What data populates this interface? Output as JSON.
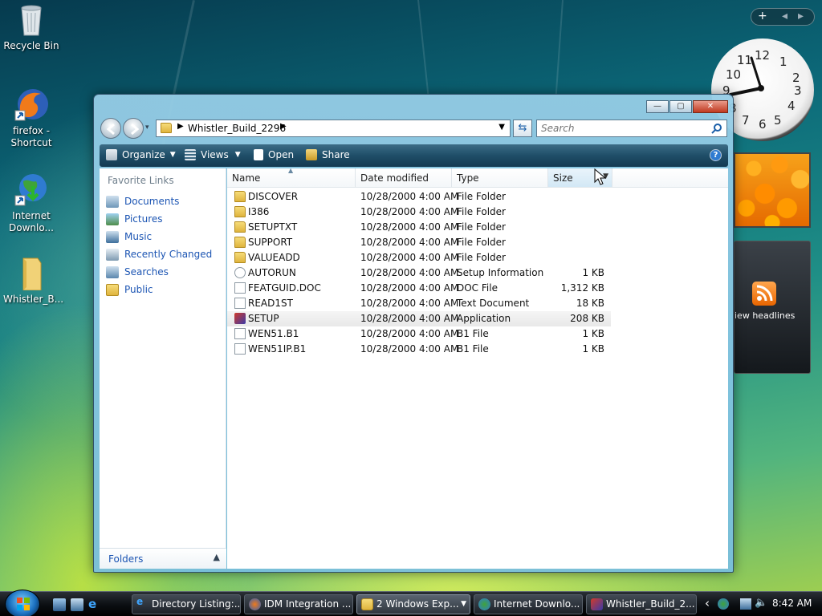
{
  "desktop": {
    "icons": [
      {
        "label": "Recycle Bin"
      },
      {
        "label": "firefox -\nShortcut"
      },
      {
        "label": "Internet\nDownlo..."
      },
      {
        "label": "Whistler_B..."
      }
    ]
  },
  "gadgets": {
    "clock_numbers": [
      "12",
      "1",
      "2",
      "3",
      "4",
      "5",
      "6",
      "7",
      "8",
      "9",
      "10",
      "11"
    ],
    "feed_label": "iew headlines",
    "sidebar_buttons": {
      "add": "+",
      "prev": "◂",
      "next": "▸"
    }
  },
  "window": {
    "title_buttons": {
      "minimize": "—",
      "maximize": "▢",
      "close": "✕"
    },
    "address": {
      "path": "Whistler_Build_2296"
    },
    "search": {
      "placeholder": "Search"
    },
    "toolbar": {
      "organize": "Organize",
      "views": "Views",
      "open": "Open",
      "share": "Share",
      "help": "?"
    },
    "nav": {
      "header": "Favorite Links",
      "links": [
        "Documents",
        "Pictures",
        "Music",
        "Recently Changed",
        "Searches",
        "Public"
      ],
      "folders_label": "Folders"
    },
    "columns": {
      "name": "Name",
      "date": "Date modified",
      "type": "Type",
      "size": "Size"
    },
    "files": [
      {
        "name": "DISCOVER",
        "date": "10/28/2000 4:00 AM",
        "type": "File Folder",
        "size": "",
        "icon": "folder"
      },
      {
        "name": "I386",
        "date": "10/28/2000 4:00 AM",
        "type": "File Folder",
        "size": "",
        "icon": "folder"
      },
      {
        "name": "SETUPTXT",
        "date": "10/28/2000 4:00 AM",
        "type": "File Folder",
        "size": "",
        "icon": "folder"
      },
      {
        "name": "SUPPORT",
        "date": "10/28/2000 4:00 AM",
        "type": "File Folder",
        "size": "",
        "icon": "folder"
      },
      {
        "name": "VALUEADD",
        "date": "10/28/2000 4:00 AM",
        "type": "File Folder",
        "size": "",
        "icon": "folder"
      },
      {
        "name": "AUTORUN",
        "date": "10/28/2000 4:00 AM",
        "type": "Setup Information",
        "size": "1 KB",
        "icon": "inf"
      },
      {
        "name": "FEATGUID.DOC",
        "date": "10/28/2000 4:00 AM",
        "type": "DOC File",
        "size": "1,312 KB",
        "icon": "doc"
      },
      {
        "name": "READ1ST",
        "date": "10/28/2000 4:00 AM",
        "type": "Text Document",
        "size": "18 KB",
        "icon": "doc"
      },
      {
        "name": "SETUP",
        "date": "10/28/2000 4:00 AM",
        "type": "Application",
        "size": "208 KB",
        "icon": "setup"
      },
      {
        "name": "WEN51.B1",
        "date": "10/28/2000 4:00 AM",
        "type": "B1 File",
        "size": "1 KB",
        "icon": "doc"
      },
      {
        "name": "WEN51IP.B1",
        "date": "10/28/2000 4:00 AM",
        "type": "B1 File",
        "size": "1 KB",
        "icon": "doc"
      }
    ]
  },
  "taskbar": {
    "buttons": [
      {
        "label": "Directory Listing:..."
      },
      {
        "label": "IDM Integration ..."
      },
      {
        "label": "2 Windows Exp..."
      },
      {
        "label": "Internet Downlo..."
      },
      {
        "label": "Whistler_Build_2..."
      }
    ],
    "tray_chevron": "‹",
    "clock": "8:42 AM"
  }
}
